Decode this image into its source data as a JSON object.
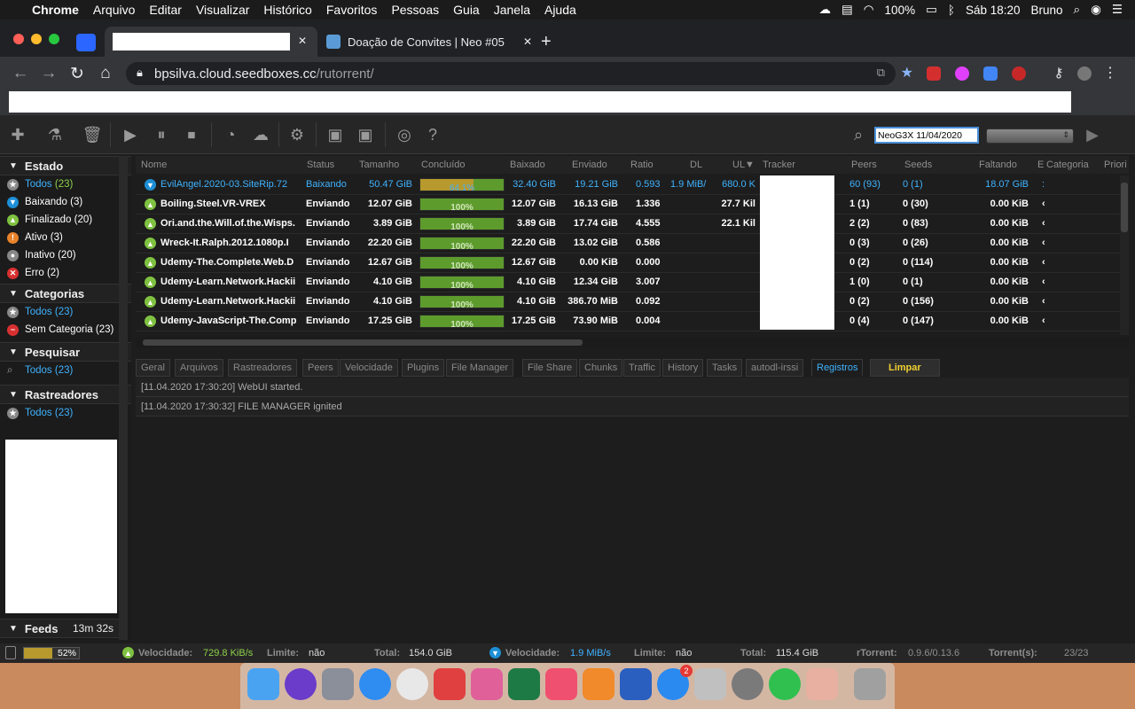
{
  "menubar": {
    "app": "Chrome",
    "items": [
      "Arquivo",
      "Editar",
      "Visualizar",
      "Histórico",
      "Favoritos",
      "Pessoas",
      "Guia",
      "Janela",
      "Ajuda"
    ],
    "battery": "100%",
    "clock": "Sáb 18:20",
    "user": "Bruno"
  },
  "browser": {
    "tab2_title": "Doação de Convites | Neo #05",
    "new_tab": "+",
    "close": "✕",
    "url_host": "bpsilva.cloud.seedboxes.cc",
    "url_path": "/rutorrent/"
  },
  "toolbar": {
    "search_value": "NeoG3X 11/04/2020",
    "help": "?"
  },
  "sidebar": {
    "estado": {
      "title": "Estado",
      "items": [
        {
          "label": "Todos",
          "count": "(23)",
          "icon": "star-icon",
          "color": "#888888"
        },
        {
          "label": "Baixando",
          "count": "(3)",
          "icon": "arrow-down-icon",
          "color": "#1e8fd6"
        },
        {
          "label": "Finalizado",
          "count": "(20)",
          "icon": "arrow-up-icon",
          "color": "#7fc241"
        },
        {
          "label": "Ativo",
          "count": "(3)",
          "icon": "exclamation-icon",
          "color": "#e8822a"
        },
        {
          "label": "Inativo",
          "count": "(20)",
          "icon": "circle-icon",
          "color": "#888888"
        },
        {
          "label": "Erro",
          "count": "(2)",
          "icon": "x-icon",
          "color": "#d83030"
        }
      ]
    },
    "categorias": {
      "title": "Categorias",
      "items": [
        {
          "label": "Todos",
          "count": "(23)"
        },
        {
          "label": "Sem Categoria",
          "count": "(23)"
        }
      ]
    },
    "pesquisar": {
      "title": "Pesquisar",
      "item": "Todos",
      "count": "(23)"
    },
    "rastreadores": {
      "title": "Rastreadores",
      "item": "Todos",
      "count": "(23)"
    },
    "feeds": {
      "title": "Feeds",
      "time": "13m 32s"
    }
  },
  "grid": {
    "columns": [
      "Nome",
      "Status",
      "Tamanho",
      "Concluído",
      "Baixado",
      "Enviado",
      "Ratio",
      "DL",
      "UL▼",
      "Tracker",
      "Peers",
      "Seeds",
      "Faltando",
      "E",
      "Categoria",
      "Priori"
    ],
    "rows": [
      {
        "name": "EvilAngel.2020-03.SiteRip.72",
        "status": "Baixando",
        "size": "50.47 GiB",
        "done": "64.1%",
        "done_frac": 0.641,
        "down": "32.40 GiB",
        "up": "19.21 GiB",
        "ratio": "0.593",
        "dl": "1.9 MiB/",
        "ul": "680.0 K",
        "peers": "60 (93)",
        "seeds": "0 (1)",
        "left": "18.07 GiB",
        "e": ":",
        "downloading": true
      },
      {
        "name": "Boiling.Steel.VR-VREX",
        "status": "Enviando",
        "size": "12.07 GiB",
        "done": "100%",
        "done_frac": 1,
        "down": "12.07 GiB",
        "up": "16.13 GiB",
        "ratio": "1.336",
        "dl": "",
        "ul": "27.7 Kil",
        "peers": "1 (1)",
        "seeds": "0 (30)",
        "left": "0.00 KiB",
        "e": "‹",
        "downloading": false
      },
      {
        "name": "Ori.and.the.Will.of.the.Wisps.",
        "status": "Enviando",
        "size": "3.89 GiB",
        "done": "100%",
        "done_frac": 1,
        "down": "3.89 GiB",
        "up": "17.74 GiB",
        "ratio": "4.555",
        "dl": "",
        "ul": "22.1 Kil",
        "peers": "2 (2)",
        "seeds": "0 (83)",
        "left": "0.00 KiB",
        "e": "‹",
        "downloading": false
      },
      {
        "name": "Wreck-It.Ralph.2012.1080p.I",
        "status": "Enviando",
        "size": "22.20 GiB",
        "done": "100%",
        "done_frac": 1,
        "down": "22.20 GiB",
        "up": "13.02 GiB",
        "ratio": "0.586",
        "dl": "",
        "ul": "",
        "peers": "0 (3)",
        "seeds": "0 (26)",
        "left": "0.00 KiB",
        "e": "‹",
        "downloading": false
      },
      {
        "name": "Udemy-The.Complete.Web.D",
        "status": "Enviando",
        "size": "12.67 GiB",
        "done": "100%",
        "done_frac": 1,
        "down": "12.67 GiB",
        "up": "0.00 KiB",
        "ratio": "0.000",
        "dl": "",
        "ul": "",
        "peers": "0 (2)",
        "seeds": "0 (114)",
        "left": "0.00 KiB",
        "e": "‹",
        "downloading": false
      },
      {
        "name": "Udemy-Learn.Network.Hackii",
        "status": "Enviando",
        "size": "4.10 GiB",
        "done": "100%",
        "done_frac": 1,
        "down": "4.10 GiB",
        "up": "12.34 GiB",
        "ratio": "3.007",
        "dl": "",
        "ul": "",
        "peers": "1 (0)",
        "seeds": "0 (1)",
        "left": "0.00 KiB",
        "e": "‹",
        "downloading": false
      },
      {
        "name": "Udemy-Learn.Network.Hackii",
        "status": "Enviando",
        "size": "4.10 GiB",
        "done": "100%",
        "done_frac": 1,
        "down": "4.10 GiB",
        "up": "386.70 MiB",
        "ratio": "0.092",
        "dl": "",
        "ul": "",
        "peers": "0 (2)",
        "seeds": "0 (156)",
        "left": "0.00 KiB",
        "e": "‹",
        "downloading": false
      },
      {
        "name": "Udemy-JavaScript-The.Comp",
        "status": "Enviando",
        "size": "17.25 GiB",
        "done": "100%",
        "done_frac": 1,
        "down": "17.25 GiB",
        "up": "73.90 MiB",
        "ratio": "0.004",
        "dl": "",
        "ul": "",
        "peers": "0 (4)",
        "seeds": "0 (147)",
        "left": "0.00 KiB",
        "e": "‹",
        "downloading": false
      }
    ]
  },
  "details": {
    "tabs": [
      "Geral",
      "Arquivos",
      "Rastreadores",
      "Peers",
      "Velocidade",
      "Plugins",
      "File Manager",
      "File Share",
      "Chunks",
      "Traffic",
      "History",
      "Tasks",
      "autodl-irssi",
      "Registros"
    ],
    "active_tab": "Registros",
    "clear_label": "Limpar",
    "log": [
      "[11.04.2020 17:30:20] WebUI started.",
      "[11.04.2020 17:30:32] FILE MANAGER ignited"
    ]
  },
  "statusbar": {
    "disk": "52%",
    "disk_frac": 0.52,
    "ul_label": "Velocidade:",
    "ul_speed": "729.8 KiB/s",
    "ul_limit_label": "Limite:",
    "ul_limit": "não",
    "ul_total_label": "Total:",
    "ul_total": "154.0 GiB",
    "dl_label": "Velocidade:",
    "dl_speed": "1.9 MiB/s",
    "dl_limit_label": "Limite:",
    "dl_limit": "não",
    "dl_total_label": "Total:",
    "dl_total": "115.4 GiB",
    "rtorrent_label": "rTorrent:",
    "rtorrent": "0.9.6/0.13.6",
    "torrents_label": "Torrent(s):",
    "torrents": "23/23"
  },
  "dock": {
    "apps": [
      "finder-icon",
      "siri-icon",
      "launchpad-icon",
      "safari-icon",
      "chrome-icon",
      "tweetbot-icon",
      "ia-writer-icon",
      "excel-icon",
      "music-icon",
      "books-icon",
      "tasks-icon",
      "app-store-icon",
      "script-editor-icon",
      "system-preferences-icon",
      "whatsapp-icon",
      "preview-icon",
      "trash-icon"
    ],
    "app_store_badge": "2"
  }
}
